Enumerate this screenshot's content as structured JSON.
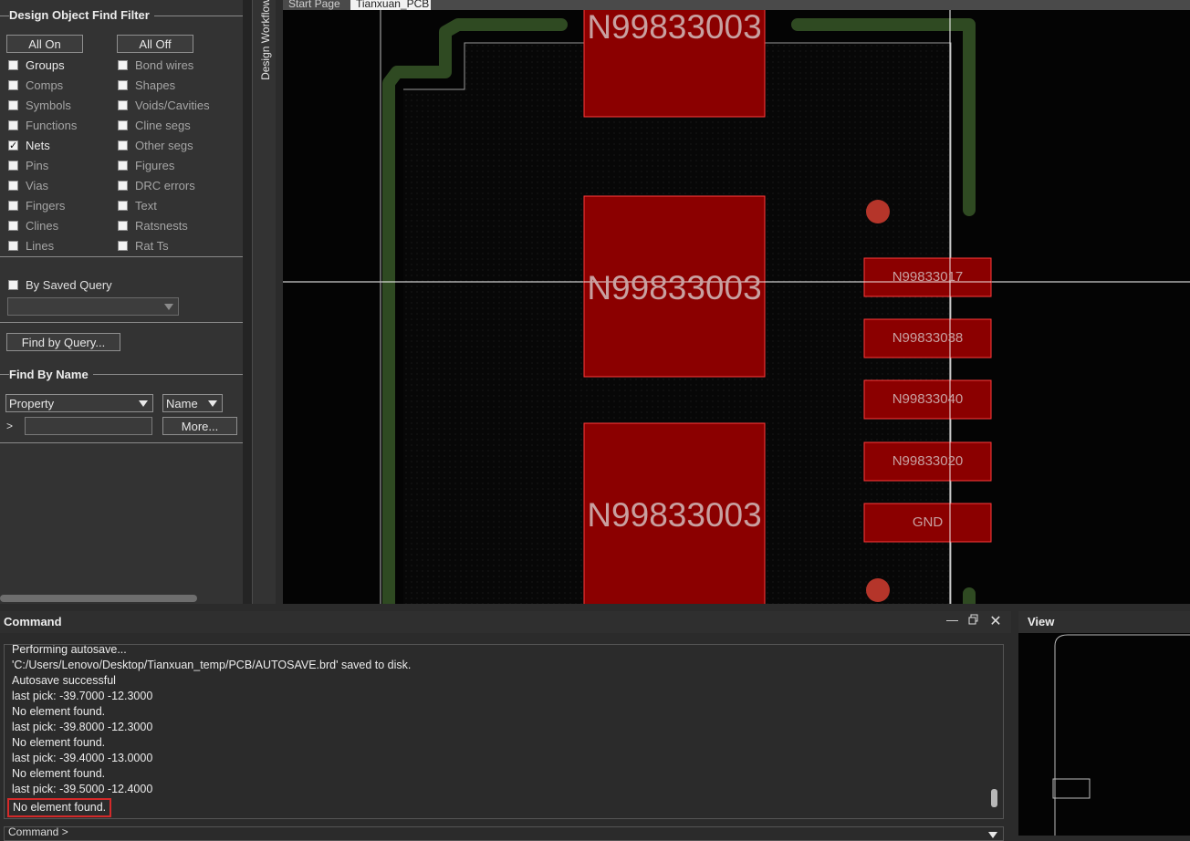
{
  "find_filter": {
    "title": "Design Object Find Filter",
    "all_on_label": "All On",
    "all_off_label": "All Off",
    "left_items": [
      {
        "label": "Groups",
        "checked": false,
        "active": true
      },
      {
        "label": "Comps",
        "checked": false,
        "active": false
      },
      {
        "label": "Symbols",
        "checked": false,
        "active": false
      },
      {
        "label": "Functions",
        "checked": false,
        "active": false
      },
      {
        "label": "Nets",
        "checked": true,
        "active": true
      },
      {
        "label": "Pins",
        "checked": false,
        "active": false
      },
      {
        "label": "Vias",
        "checked": false,
        "active": false
      },
      {
        "label": "Fingers",
        "checked": false,
        "active": false
      },
      {
        "label": "Clines",
        "checked": false,
        "active": false
      },
      {
        "label": "Lines",
        "checked": false,
        "active": false
      }
    ],
    "right_items": [
      {
        "label": "Bond wires",
        "checked": false,
        "active": false
      },
      {
        "label": "Shapes",
        "checked": false,
        "active": false
      },
      {
        "label": "Voids/Cavities",
        "checked": false,
        "active": false
      },
      {
        "label": "Cline segs",
        "checked": false,
        "active": false
      },
      {
        "label": "Other segs",
        "checked": false,
        "active": false
      },
      {
        "label": "Figures",
        "checked": false,
        "active": false
      },
      {
        "label": "DRC errors",
        "checked": false,
        "active": false
      },
      {
        "label": "Text",
        "checked": false,
        "active": false
      },
      {
        "label": "Ratsnests",
        "checked": false,
        "active": false
      },
      {
        "label": "Rat Ts",
        "checked": false,
        "active": false
      }
    ],
    "by_saved_query_label": "By Saved Query",
    "find_by_query_label": "Find by Query...",
    "find_by_name_title": "Find By Name",
    "property_value": "Property",
    "name_value": "Name",
    "prompt_symbol": ">",
    "more_label": "More..."
  },
  "workflow_tab_label": "Design Workflow",
  "canvas": {
    "tabs": [
      "Start Page",
      "Tianxuan_PCB"
    ],
    "large_pads": [
      "N99833003",
      "N99833003",
      "N99833003"
    ],
    "small_pads": [
      "N99833017",
      "N99833038",
      "N99833040",
      "N99833020",
      "GND"
    ]
  },
  "command_panel": {
    "title": "Command",
    "log": [
      "Performing autosave...",
      "'C:/Users/Lenovo/Desktop/Tianxuan_temp/PCB/AUTOSAVE.brd' saved to disk.",
      "Autosave successful",
      "last pick:  -39.7000 -12.3000",
      "No element found.",
      "last pick:  -39.8000 -12.3000",
      "No element found.",
      "last pick:  -39.4000 -13.0000",
      "No element found.",
      "last pick:  -39.5000 -12.4000",
      "No element found."
    ],
    "input_prompt": "Command >"
  },
  "view_panel": {
    "title": "View"
  },
  "colors": {
    "pad_fill": "#8b0000",
    "pad_border": "#ff3b3b",
    "pad_text": "#c8a0a0",
    "trace": "#2f4a22",
    "via": "#b5352a",
    "highlight": "#d42a2a"
  }
}
